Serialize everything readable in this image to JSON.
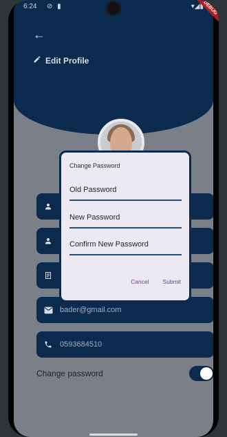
{
  "status": {
    "time": "6:24"
  },
  "header": {
    "back_label": "←",
    "title": "Edit Profile"
  },
  "fields": [
    {
      "id": "name",
      "icon": "person-icon",
      "value": ""
    },
    {
      "id": "nickname",
      "icon": "person-icon",
      "value": ""
    },
    {
      "id": "bio",
      "icon": "document-icon",
      "value": ""
    },
    {
      "id": "email",
      "icon": "mail-icon",
      "value": "bader@gmail.com"
    },
    {
      "id": "phone",
      "icon": "phone-icon",
      "value": "0593684510"
    }
  ],
  "change_password": {
    "label": "Change password",
    "enabled": true
  },
  "dialog": {
    "title": "Change Password",
    "old_placeholder": "Old Password",
    "new_placeholder": "New Password",
    "confirm_placeholder": "Confirm New Password",
    "cancel": "Cancel",
    "submit": "Submit"
  },
  "colors": {
    "primary": "#0b2b4e",
    "dialog_bg": "#ece9f2",
    "accent_text": "#5b4a86"
  },
  "debug_banner": "DEBUG"
}
